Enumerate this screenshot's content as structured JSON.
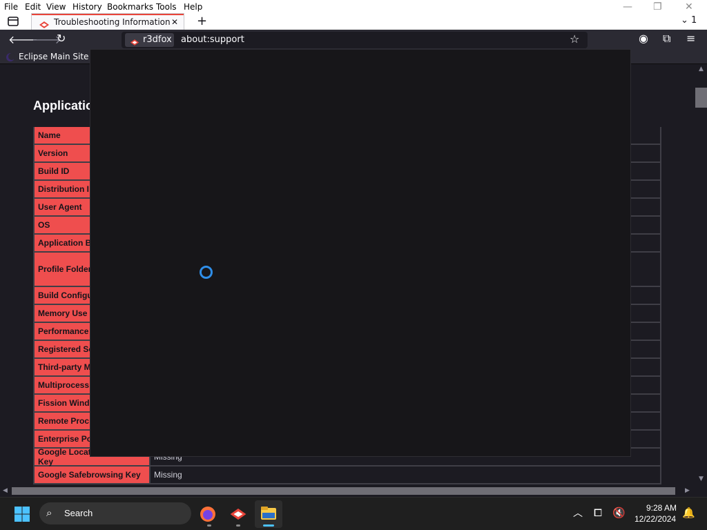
{
  "menu": [
    "File",
    "Edit",
    "View",
    "History",
    "Bookmarks",
    "Tools",
    "Help"
  ],
  "tab": {
    "title": "Troubleshooting Information",
    "counter": "1"
  },
  "identity": {
    "label": "r3dfox"
  },
  "url": "about:support",
  "bookmarks": [
    {
      "label": "Eclipse Main Site"
    }
  ],
  "page": {
    "section_title": "Applicatio",
    "rows": [
      {
        "key": "Name",
        "value": ""
      },
      {
        "key": "Version",
        "value": ""
      },
      {
        "key": "Build ID",
        "value": ""
      },
      {
        "key": "Distribution I",
        "value": ""
      },
      {
        "key": "User Agent",
        "value": ""
      },
      {
        "key": "OS",
        "value": ""
      },
      {
        "key": "Application Bi",
        "value": ""
      },
      {
        "key": "Profile Folder",
        "value": ""
      },
      {
        "key": "Build Configu",
        "value": ""
      },
      {
        "key": "Memory Use",
        "value": ""
      },
      {
        "key": "Performance",
        "value": ""
      },
      {
        "key": "Registered Se",
        "value": ""
      },
      {
        "key": "Third-party M",
        "value": ""
      },
      {
        "key": "Multiprocess",
        "value": ""
      },
      {
        "key": "Fission Windo",
        "value": ""
      },
      {
        "key": "Remote Proc",
        "value": ""
      },
      {
        "key": "Enterprise Po",
        "value": ""
      },
      {
        "key": "Google Location Service Key",
        "value": "Missing"
      },
      {
        "key": "Google Safebrowsing Key",
        "value": "Missing"
      }
    ]
  },
  "taskbar": {
    "search_label": "Search",
    "time": "9:28 AM",
    "date": "12/22/2024"
  },
  "colors": {
    "accent_red": "#ef4e4e",
    "spinner_blue": "#2f8ee8"
  }
}
